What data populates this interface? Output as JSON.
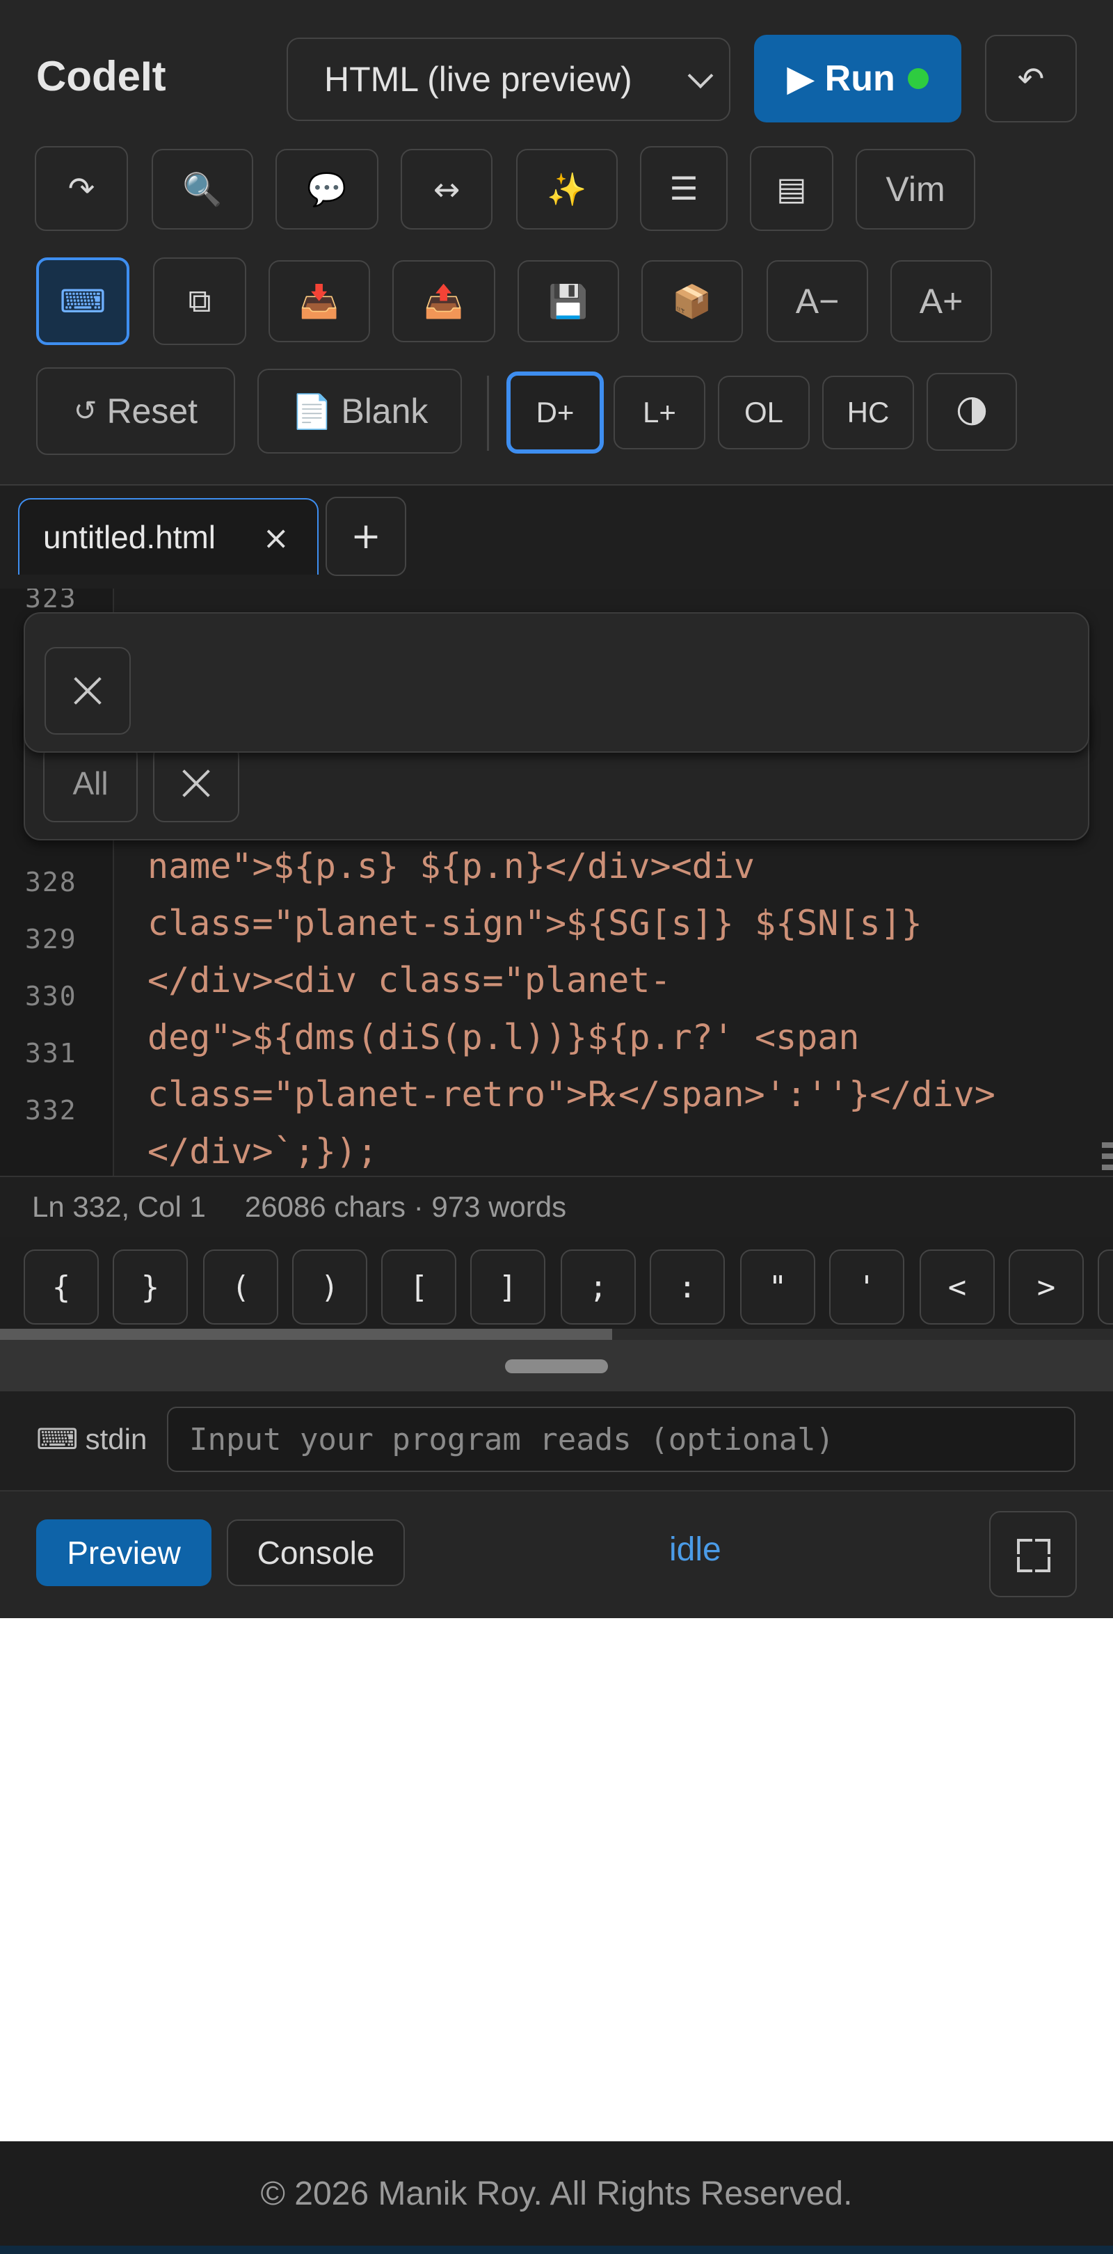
{
  "app": {
    "brand": "CodeIt"
  },
  "header": {
    "language_selected": "HTML (live preview)",
    "run_label": "▶ Run",
    "undo_icon": "↶"
  },
  "toolbar_row1": [
    {
      "name": "redo-button",
      "icon": "redo-icon",
      "glyph": "↷"
    },
    {
      "name": "search-button",
      "icon": "search-icon",
      "glyph": "🔍"
    },
    {
      "name": "comment-button",
      "icon": "speech-bubble-icon",
      "glyph": "💬"
    },
    {
      "name": "wrap-button",
      "icon": "horizontal-arrows-icon",
      "glyph": "↔"
    },
    {
      "name": "format-button",
      "icon": "sparkles-icon",
      "glyph": "✨"
    },
    {
      "name": "menu-button",
      "icon": "hamburger-icon",
      "glyph": "☰"
    },
    {
      "name": "panel-button",
      "icon": "panel-icon",
      "glyph": "▤"
    },
    {
      "name": "vim-button",
      "label": "Vim"
    }
  ],
  "toolbar_row2": [
    {
      "name": "keyboard-button",
      "icon": "keyboard-icon",
      "glyph": "⌨",
      "active": true
    },
    {
      "name": "duplicate-button",
      "icon": "copy-icon",
      "glyph": "⧉"
    },
    {
      "name": "import-button",
      "icon": "inbox-icon",
      "glyph": "📥"
    },
    {
      "name": "export-button",
      "icon": "outbox-icon",
      "glyph": "📤"
    },
    {
      "name": "save-button",
      "icon": "floppy-disk-icon",
      "glyph": "💾"
    },
    {
      "name": "package-button",
      "icon": "package-icon",
      "glyph": "📦"
    },
    {
      "name": "font-decrease-button",
      "label": "A−"
    },
    {
      "name": "font-increase-button",
      "label": "A+"
    }
  ],
  "toolbar_row3": {
    "reset_glyph": "↺",
    "reset_label": "Reset",
    "blank_glyph": "📄",
    "blank_label": "Blank",
    "themes": [
      {
        "name": "theme-dark-plus-button",
        "label": "D+",
        "active": true
      },
      {
        "name": "theme-light-plus-button",
        "label": "L+"
      },
      {
        "name": "theme-ol-button",
        "label": "OL"
      },
      {
        "name": "theme-hc-button",
        "label": "HC"
      },
      {
        "name": "theme-toggle-button",
        "label": "🌗"
      }
    ]
  },
  "tabs": {
    "file_name": "untitled.html",
    "close_glyph": "×",
    "add_glyph": "+"
  },
  "find_panel": {
    "all_label": "All"
  },
  "editor": {
    "lines": [
      {
        "num": "323",
        "text": ""
      },
      {
        "num": "328",
        "text": "name\">${p.s} ${p.n}</div><div"
      },
      {
        "num": "329",
        "text": "class=\"planet-sign\">${SG[s]} ${SN[s]}"
      },
      {
        "num": "330",
        "text": "</div><div class=\"planet-"
      },
      {
        "num": "331",
        "text": "deg\">${dms(diS(p.l))}${p.r?' <span"
      },
      {
        "num": "332",
        "text": "class=\"planet-retro\">℞</span>':''}</div>"
      },
      {
        "num": "",
        "text": "</div>`;});"
      }
    ]
  },
  "status_bar": {
    "position": "Ln 332, Col 1",
    "counts": "26086 chars · 973 words"
  },
  "keys": [
    "{",
    "}",
    "(",
    ")",
    "[",
    "]",
    ";",
    ":",
    "\"",
    "'",
    "<",
    ">"
  ],
  "stdin": {
    "icon_glyph": "⌨",
    "label": "stdin",
    "placeholder": "Input your program reads (optional)"
  },
  "output": {
    "preview_label": "Preview",
    "console_label": "Console",
    "status": "idle"
  },
  "footer": {
    "text": "© 2026 Manik Roy. All Rights Reserved."
  },
  "colors": {
    "accent": "#0e63a8",
    "active_border": "#3e8ef0",
    "run_dot": "#2ecc40",
    "code_string": "#ce9178",
    "status_idle": "#4b9ce8"
  }
}
